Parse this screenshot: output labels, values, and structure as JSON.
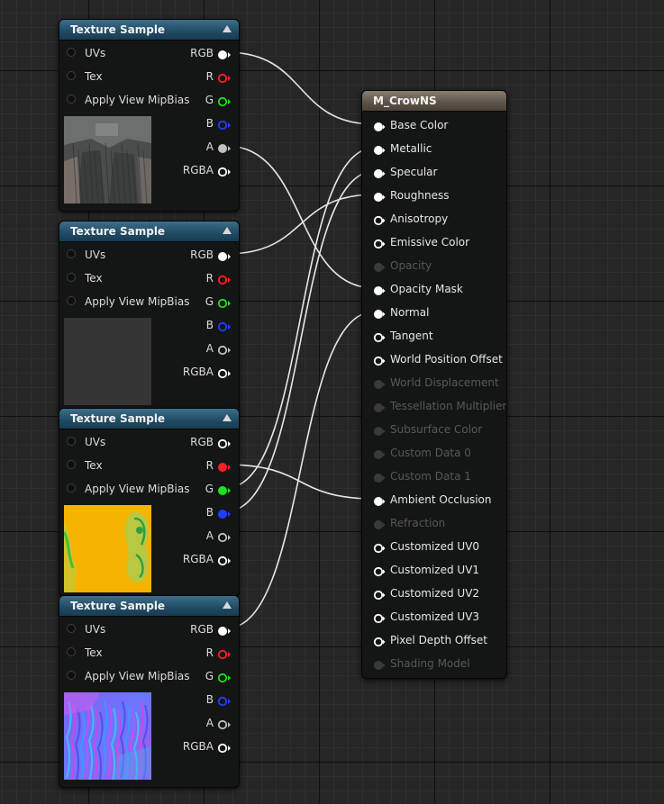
{
  "texture_nodes": [
    {
      "title": "Texture Sample",
      "inputs": [
        "UVs",
        "Tex",
        "Apply View MipBias"
      ],
      "outputs": [
        "RGB",
        "R",
        "G",
        "B",
        "A",
        "RGBA"
      ],
      "thumbnail": "gray-rock-texture"
    },
    {
      "title": "Texture Sample",
      "inputs": [
        "UVs",
        "Tex",
        "Apply View MipBias"
      ],
      "outputs": [
        "RGB",
        "R",
        "G",
        "B",
        "A",
        "RGBA"
      ],
      "thumbnail": "flat-dark-gray"
    },
    {
      "title": "Texture Sample",
      "inputs": [
        "UVs",
        "Tex",
        "Apply View MipBias"
      ],
      "outputs": [
        "RGB",
        "R",
        "G",
        "B",
        "A",
        "RGBA"
      ],
      "thumbnail": "yellow-green-mask"
    },
    {
      "title": "Texture Sample",
      "inputs": [
        "UVs",
        "Tex",
        "Apply View MipBias"
      ],
      "outputs": [
        "RGB",
        "R",
        "G",
        "B",
        "A",
        "RGBA"
      ],
      "thumbnail": "blue-purple-normal-map"
    }
  ],
  "material_node": {
    "title": "M_CrowNS",
    "inputs": [
      {
        "label": "Base Color",
        "enabled": true
      },
      {
        "label": "Metallic",
        "enabled": true
      },
      {
        "label": "Specular",
        "enabled": true
      },
      {
        "label": "Roughness",
        "enabled": true
      },
      {
        "label": "Anisotropy",
        "enabled": true
      },
      {
        "label": "Emissive Color",
        "enabled": true
      },
      {
        "label": "Opacity",
        "enabled": false
      },
      {
        "label": "Opacity Mask",
        "enabled": true
      },
      {
        "label": "Normal",
        "enabled": true
      },
      {
        "label": "Tangent",
        "enabled": true
      },
      {
        "label": "World Position Offset",
        "enabled": true
      },
      {
        "label": "World Displacement",
        "enabled": false
      },
      {
        "label": "Tessellation Multiplier",
        "enabled": false
      },
      {
        "label": "Subsurface Color",
        "enabled": false
      },
      {
        "label": "Custom Data 0",
        "enabled": false
      },
      {
        "label": "Custom Data 1",
        "enabled": false
      },
      {
        "label": "Ambient Occlusion",
        "enabled": true
      },
      {
        "label": "Refraction",
        "enabled": false
      },
      {
        "label": "Customized UV0",
        "enabled": true
      },
      {
        "label": "Customized UV1",
        "enabled": true
      },
      {
        "label": "Customized UV2",
        "enabled": true
      },
      {
        "label": "Customized UV3",
        "enabled": true
      },
      {
        "label": "Pixel Depth Offset",
        "enabled": true
      },
      {
        "label": "Shading Model",
        "enabled": false
      }
    ]
  },
  "pin_colors": {
    "RGB": "#ffffff",
    "R": "#ff2020",
    "G": "#20e020",
    "B": "#2040ff",
    "A": "#c0c0c0",
    "RGBA": "#ffffff",
    "material": "#ffffff",
    "disabled": "#3a3a3a"
  },
  "connections": [
    {
      "from_node": 0,
      "from_pin": "RGB",
      "to": "Base Color"
    },
    {
      "from_node": 0,
      "from_pin": "A",
      "to": "Opacity Mask"
    },
    {
      "from_node": 1,
      "from_pin": "RGB",
      "to": "Roughness"
    },
    {
      "from_node": 2,
      "from_pin": "R",
      "to": "Ambient Occlusion"
    },
    {
      "from_node": 2,
      "from_pin": "G",
      "to": "Metallic"
    },
    {
      "from_node": 2,
      "from_pin": "B",
      "to": "Specular"
    },
    {
      "from_node": 3,
      "from_pin": "RGB",
      "to": "Normal"
    }
  ]
}
